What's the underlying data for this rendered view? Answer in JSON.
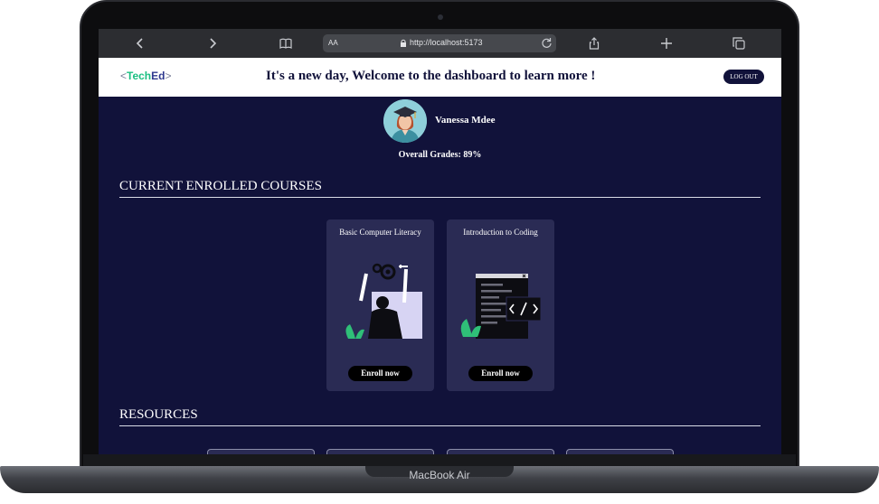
{
  "device": {
    "model_label": "MacBook Air"
  },
  "browser": {
    "text_size_label": "AA",
    "url": "http://localhost:5173",
    "icons": [
      "back-icon",
      "forward-icon",
      "bookmarks-icon",
      "lock-icon",
      "reload-icon",
      "share-icon",
      "new-tab-icon",
      "tabs-icon"
    ]
  },
  "header": {
    "logo": {
      "bracket_open": "<",
      "part1": "Tech",
      "part2": "Ed",
      "bracket_close": ">"
    },
    "welcome": "It's a new day, Welcome to the dashboard to learn more !",
    "logout_label": "LOG OUT"
  },
  "profile": {
    "name": "Vanessa Mdee",
    "overall_grades": "Overall Grades: 89%"
  },
  "sections": {
    "courses_title": "CURRENT ENROLLED COURSES",
    "resources_title": "RESOURCES"
  },
  "courses": [
    {
      "title": "Basic Computer Literacy",
      "button": "Enroll now",
      "illustration": "person-with-gears-illustration"
    },
    {
      "title": "Introduction to Coding",
      "button": "Enroll now",
      "illustration": "code-window-illustration"
    }
  ],
  "colors": {
    "page_background": "#11123a",
    "card_background": "#2a2b54",
    "accent_green": "#1bbf82",
    "logo_blue": "#2f3a8f"
  }
}
